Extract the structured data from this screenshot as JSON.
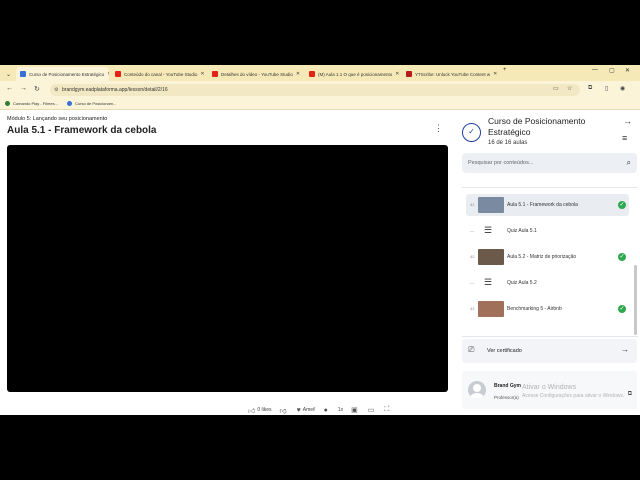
{
  "browser": {
    "tabs": [
      {
        "title": "Curso de Posicionamento Estratégico",
        "color": "#3b6fd8"
      },
      {
        "title": "Conteúdo do canal - YouTube Studio",
        "color": "#e62117"
      },
      {
        "title": "Detalhes do vídeo - YouTube Studio",
        "color": "#e62117"
      },
      {
        "title": "(M) Aula 1.1 O que é posicionamento",
        "color": "#e62117"
      },
      {
        "title": "YTScribe: Unlock YouTube Content w",
        "color": "#b71c1c"
      }
    ],
    "url": "brandgym.eadplataforma.app/lesson/detail/2/16",
    "bookmarks": [
      {
        "label": "Comando Play - Filmes...",
        "color": "#2e7d32"
      },
      {
        "label": "Curso de Posicionam...",
        "color": "#3b6fd8"
      }
    ]
  },
  "lesson": {
    "module": "Módulo 5: Lançando seu posicionamento",
    "title": "Aula 5.1 - Framework da cebola"
  },
  "player": {
    "likes": "0 likes",
    "love": "Amei!",
    "speed": "1x"
  },
  "course": {
    "title": "Curso de Posicionamento Estratégico",
    "count": "16 de 16 aulas",
    "search_placeholder": "Pesquisar por conteúdos...",
    "items": [
      {
        "num": "41",
        "label": "Aula 5.1 - Framework da cebola",
        "kind": "video",
        "thumb": "#7a8aa0",
        "completed": true,
        "current": true
      },
      {
        "num": "—",
        "label": "Quiz Aula 5.1",
        "kind": "quiz",
        "completed": false,
        "current": false
      },
      {
        "num": "42",
        "label": "Aula 5.2 - Matriz de priorização",
        "kind": "video",
        "thumb": "#6b5a4a",
        "completed": true,
        "current": false
      },
      {
        "num": "—",
        "label": "Quiz Aula 5.2",
        "kind": "quiz",
        "completed": false,
        "current": false
      },
      {
        "num": "43",
        "label": "Benchmarking 5 - Airbnb",
        "kind": "video",
        "thumb": "#a0705a",
        "completed": true,
        "current": false
      }
    ],
    "certificate": "Ver certificado",
    "instructor_name": "Brand Gym",
    "instructor_role": "Professor(a)"
  },
  "watermark": {
    "line1": "Ativar o Windows",
    "line2": "Acesse Configurações para ativar o Windows."
  }
}
